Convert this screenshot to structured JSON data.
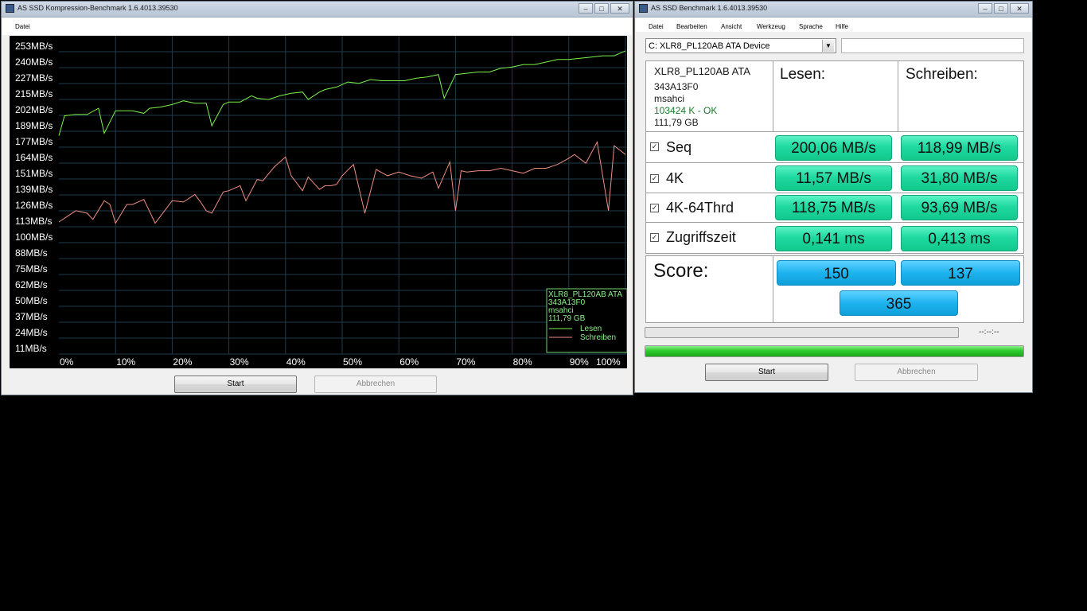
{
  "left_window": {
    "title": "AS SSD Kompression-Benchmark 1.6.4013.39530",
    "menu": [
      "Datei"
    ],
    "start_label": "Start",
    "cancel_label": "Abbrechen"
  },
  "right_window": {
    "title": "AS SSD Benchmark 1.6.4013.39530",
    "menu": [
      "Datei",
      "Bearbeiten",
      "Ansicht",
      "Werkzeug",
      "Sprache",
      "Hilfe"
    ],
    "drive_select": "C: XLR8_PL120AB ATA Device",
    "drive_info": {
      "model": "XLR8_PL120AB ATA",
      "firmware": "343A13F0",
      "driver": "msahci",
      "alignment": "103424 K - OK",
      "size": "111,79 GB"
    },
    "col_read": "Lesen:",
    "col_write": "Schreiben:",
    "rows": [
      {
        "label": "Seq",
        "checked": true,
        "read": "200,06 MB/s",
        "write": "118,99 MB/s"
      },
      {
        "label": "4K",
        "checked": true,
        "read": "11,57 MB/s",
        "write": "31,80 MB/s"
      },
      {
        "label": "4K-64Thrd",
        "checked": true,
        "read": "118,75 MB/s",
        "write": "93,69 MB/s"
      },
      {
        "label": "Zugriffszeit",
        "checked": true,
        "read": "0,141 ms",
        "write": "0,413 ms"
      }
    ],
    "score_label": "Score:",
    "score_read": "150",
    "score_write": "137",
    "score_total": "365",
    "time_display": "--:--:--",
    "progress_top": 0,
    "progress_bottom": 1.0,
    "start_label": "Start",
    "cancel_label": "Abbrechen"
  },
  "chart_data": {
    "type": "line",
    "y_tick_labels": [
      "253MB/s",
      "240MB/s",
      "227MB/s",
      "215MB/s",
      "202MB/s",
      "189MB/s",
      "177MB/s",
      "164MB/s",
      "151MB/s",
      "139MB/s",
      "126MB/s",
      "113MB/s",
      "100MB/s",
      "88MB/s",
      "75MB/s",
      "62MB/s",
      "50MB/s",
      "37MB/s",
      "24MB/s",
      "11MB/s"
    ],
    "x_tick_labels": [
      "0%",
      "10%",
      "20%",
      "30%",
      "40%",
      "50%",
      "60%",
      "70%",
      "80%",
      "90%",
      "100%"
    ],
    "ylim": [
      0,
      260
    ],
    "xlim": [
      0,
      100
    ],
    "grid": true,
    "legend_info": [
      "XLR8_PL120AB ATA",
      "343A13F0",
      "msahci",
      "111,79 GB"
    ],
    "series": [
      {
        "name": "Lesen",
        "color": "#7cf24a",
        "x": [
          0,
          1,
          3,
          5,
          7,
          8,
          10,
          12,
          13,
          15,
          16,
          18,
          20,
          22,
          24,
          26,
          27,
          29,
          30,
          32,
          34,
          35,
          37,
          39,
          41,
          43,
          44,
          46,
          47,
          49,
          51,
          53,
          55,
          57,
          59,
          61,
          63,
          65,
          67,
          68,
          70,
          72,
          74,
          76,
          78,
          80,
          82,
          84,
          86,
          88,
          90,
          92,
          94,
          96,
          98,
          100
        ],
        "y": [
          180,
          196,
          197,
          197,
          202,
          182,
          200,
          200,
          200,
          198,
          202,
          203,
          205,
          208,
          206,
          206,
          188,
          205,
          207,
          207,
          212,
          210,
          209,
          212,
          214,
          215,
          209,
          215,
          217,
          219,
          223,
          222,
          225,
          224,
          224,
          224,
          226,
          227,
          229,
          210,
          229,
          230,
          231,
          231,
          234,
          235,
          237,
          237,
          239,
          241,
          241,
          242,
          243,
          244,
          244,
          248
        ]
      },
      {
        "name": "Schreiben",
        "color": "#ef8e84",
        "x": [
          0,
          2,
          3,
          5,
          6,
          8,
          9,
          10,
          12,
          13,
          15,
          17,
          19,
          20,
          22,
          24,
          25,
          26,
          27,
          29,
          30,
          32,
          33,
          35,
          36,
          38,
          40,
          41,
          43,
          44,
          46,
          47,
          48,
          49,
          50,
          52,
          54,
          56,
          58,
          60,
          62,
          64,
          66,
          67,
          69,
          70,
          71,
          72,
          74,
          76,
          78,
          80,
          82,
          84,
          86,
          88,
          90,
          91,
          93,
          95,
          97,
          98,
          100
        ],
        "y": [
          111,
          117,
          120,
          118,
          113,
          128,
          125,
          110,
          125,
          125,
          129,
          110,
          122,
          128,
          127,
          133,
          127,
          120,
          118,
          135,
          136,
          140,
          128,
          145,
          144,
          155,
          163,
          148,
          136,
          147,
          137,
          140,
          140,
          141,
          148,
          157,
          118,
          153,
          148,
          151,
          148,
          146,
          151,
          138,
          159,
          120,
          152,
          151,
          152,
          152,
          154,
          152,
          150,
          154,
          154,
          157,
          162,
          165,
          158,
          175,
          120,
          172,
          165
        ]
      }
    ]
  }
}
